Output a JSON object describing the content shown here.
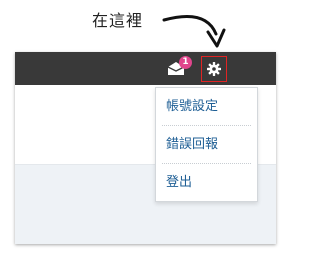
{
  "annotation": {
    "text": "在這裡"
  },
  "topbar": {
    "background": "#393939",
    "mail_badge_count": "1",
    "mail_badge_color": "#e0458c",
    "gear_highlight_color": "#e02424",
    "icons": [
      "mail-icon",
      "gear-icon"
    ]
  },
  "dropdown": {
    "items": [
      {
        "label": "帳號設定"
      },
      {
        "label": "錯誤回報"
      },
      {
        "label": "登出"
      }
    ],
    "link_color": "#1f5f95"
  }
}
